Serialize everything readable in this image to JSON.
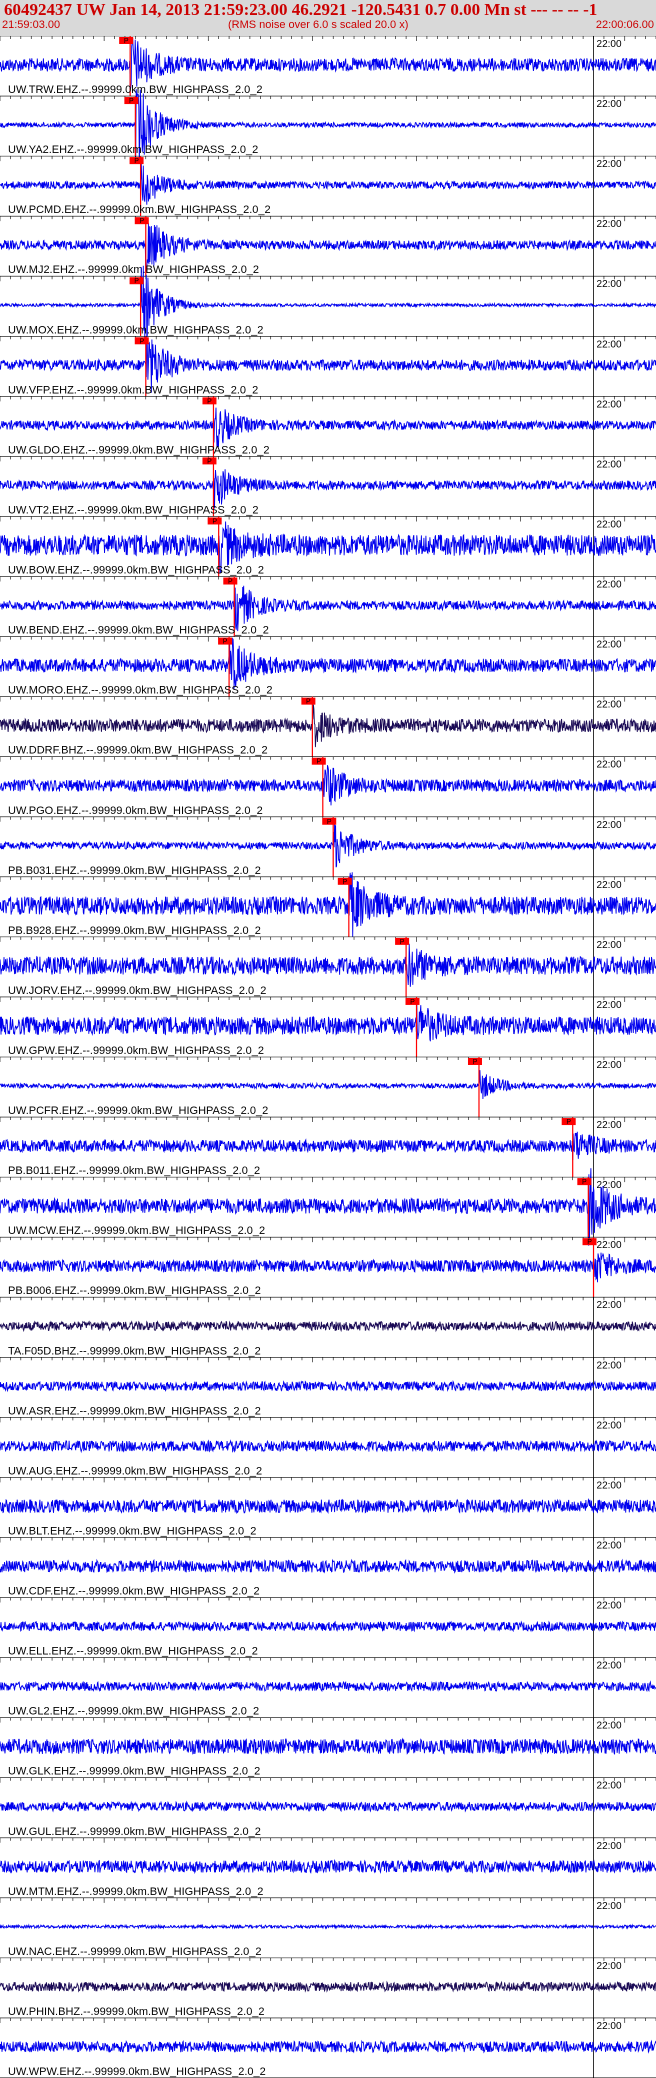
{
  "header": {
    "title": "60492437 UW Jan 14, 2013 21:59:23.00   46.2921 -120.5431  0.7 0.00 Mn st --- -- --  -1",
    "start_time": "21:59:03.00",
    "end_time": "22:00:06.00",
    "subtitle": "(RMS noise over 6.0 s scaled 20.0 x)"
  },
  "colors": {
    "background": "#ffffff",
    "header_bg": "#d9d9d9",
    "header_text": "#cc0000",
    "trace": "#0000ee",
    "trace_dark": "#1a0a55",
    "pick": "#ff0000",
    "label": "#000000"
  },
  "chart_data": {
    "type": "line",
    "x_unit": "time",
    "xlim": [
      "21:59:03.00",
      "22:00:06.00"
    ],
    "tick_interval_s": 1,
    "minute_tick_label": "22:00",
    "pick_label": "P",
    "traces": [
      {
        "label": "UW.TRW.EHZ.--.99999.0km.BW_HIGHPASS_2.0_2",
        "pick_s": 12.5,
        "amp": 0.22,
        "burst": 1.0,
        "color": "trace"
      },
      {
        "label": "UW.YA2.EHZ.--.99999.0km.BW_HIGHPASS_2.0_2",
        "pick_s": 13.0,
        "amp": 0.08,
        "burst": 1.6,
        "color": "trace"
      },
      {
        "label": "UW.PCMD.EHZ.--.99999.0km.BW_HIGHPASS_2.0_2",
        "pick_s": 13.5,
        "amp": 0.12,
        "burst": 0.8,
        "color": "trace"
      },
      {
        "label": "UW.MJ2.EHZ.--.99999.0km.BW_HIGHPASS_2.0_2",
        "pick_s": 14.0,
        "amp": 0.15,
        "burst": 1.0,
        "color": "trace"
      },
      {
        "label": "UW.MOX.EHZ.--.99999.0km.BW_HIGHPASS_2.0_2",
        "pick_s": 13.5,
        "amp": 0.05,
        "burst": 1.5,
        "color": "trace"
      },
      {
        "label": "UW.VFP.EHZ.--.99999.0km.BW_HIGHPASS_2.0_2",
        "pick_s": 14.0,
        "amp": 0.18,
        "burst": 1.1,
        "color": "trace"
      },
      {
        "label": "UW.GLDO.EHZ.--.99999.0km.BW_HIGHPASS_2.0_2",
        "pick_s": 20.5,
        "amp": 0.15,
        "burst": 0.8,
        "color": "trace"
      },
      {
        "label": "UW.VT2.EHZ.--.99999.0km.BW_HIGHPASS_2.0_2",
        "pick_s": 20.5,
        "amp": 0.15,
        "burst": 0.8,
        "color": "trace"
      },
      {
        "label": "UW.BOW.EHZ.--.99999.0km.BW_HIGHPASS_2.0_2",
        "pick_s": 21.0,
        "amp": 0.35,
        "burst": 0.7,
        "color": "trace"
      },
      {
        "label": "UW.BEND.EHZ.--.99999.0km.BW_HIGHPASS_2.0_2",
        "pick_s": 22.5,
        "amp": 0.15,
        "burst": 0.9,
        "color": "trace"
      },
      {
        "label": "UW.MORO.EHZ.--.99999.0km.BW_HIGHPASS_2.0_2",
        "pick_s": 22.0,
        "amp": 0.22,
        "burst": 0.9,
        "color": "trace"
      },
      {
        "label": "UW.DDRF.BHZ.--.99999.0km.BW_HIGHPASS_2.0_2",
        "pick_s": 30.0,
        "amp": 0.22,
        "burst": 0.6,
        "color": "trace_dark"
      },
      {
        "label": "UW.PGO.EHZ.--.99999.0km.BW_HIGHPASS_2.0_2",
        "pick_s": 31.0,
        "amp": 0.2,
        "burst": 0.8,
        "color": "trace"
      },
      {
        "label": "PB.B031.EHZ.--.99999.0km.BW_HIGHPASS_2.0_2",
        "pick_s": 32.0,
        "amp": 0.12,
        "burst": 0.8,
        "color": "trace"
      },
      {
        "label": "PB.B928.EHZ.--.99999.0km.BW_HIGHPASS_2.0_2",
        "pick_s": 33.5,
        "amp": 0.3,
        "burst": 1.0,
        "color": "trace"
      },
      {
        "label": "UW.JORV.EHZ.--.99999.0km.BW_HIGHPASS_2.0_2",
        "pick_s": 39.0,
        "amp": 0.3,
        "burst": 0.6,
        "color": "trace"
      },
      {
        "label": "UW.GPW.EHZ.--.99999.0km.BW_HIGHPASS_2.0_2",
        "pick_s": 40.0,
        "amp": 0.3,
        "burst": 0.6,
        "color": "trace"
      },
      {
        "label": "UW.PCFR.EHZ.--.99999.0km.BW_HIGHPASS_2.0_2",
        "pick_s": 46.0,
        "amp": 0.08,
        "burst": 0.5,
        "color": "trace"
      },
      {
        "label": "PB.B011.EHZ.--.99999.0km.BW_HIGHPASS_2.0_2",
        "pick_s": 55.0,
        "amp": 0.2,
        "burst": 0.5,
        "color": "trace"
      },
      {
        "label": "UW.MCW.EHZ.--.99999.0km.BW_HIGHPASS_2.0_2",
        "pick_s": 56.5,
        "amp": 0.25,
        "burst": 1.2,
        "color": "trace"
      },
      {
        "label": "PB.B006.EHZ.--.99999.0km.BW_HIGHPASS_2.0_2",
        "pick_s": 57.0,
        "amp": 0.2,
        "burst": 0.5,
        "color": "trace"
      },
      {
        "label": "TA.F05D.BHZ.--.99999.0km.BW_HIGHPASS_2.0_2",
        "pick_s": null,
        "amp": 0.15,
        "burst": 0,
        "color": "trace_dark"
      },
      {
        "label": "UW.ASR.EHZ.--.99999.0km.BW_HIGHPASS_2.0_2",
        "pick_s": null,
        "amp": 0.15,
        "burst": 0,
        "color": "trace"
      },
      {
        "label": "UW.AUG.EHZ.--.99999.0km.BW_HIGHPASS_2.0_2",
        "pick_s": null,
        "amp": 0.18,
        "burst": 0,
        "color": "trace"
      },
      {
        "label": "UW.BLT.EHZ.--.99999.0km.BW_HIGHPASS_2.0_2",
        "pick_s": null,
        "amp": 0.22,
        "burst": 0,
        "color": "trace"
      },
      {
        "label": "UW.CDF.EHZ.--.99999.0km.BW_HIGHPASS_2.0_2",
        "pick_s": null,
        "amp": 0.2,
        "burst": 0,
        "color": "trace"
      },
      {
        "label": "UW.ELL.EHZ.--.99999.0km.BW_HIGHPASS_2.0_2",
        "pick_s": null,
        "amp": 0.15,
        "burst": 0,
        "color": "trace"
      },
      {
        "label": "UW.GL2.EHZ.--.99999.0km.BW_HIGHPASS_2.0_2",
        "pick_s": null,
        "amp": 0.15,
        "burst": 0,
        "color": "trace"
      },
      {
        "label": "UW.GLK.EHZ.--.99999.0km.BW_HIGHPASS_2.0_2",
        "pick_s": null,
        "amp": 0.25,
        "burst": 0,
        "color": "trace"
      },
      {
        "label": "UW.GUL.EHZ.--.99999.0km.BW_HIGHPASS_2.0_2",
        "pick_s": null,
        "amp": 0.15,
        "burst": 0,
        "color": "trace"
      },
      {
        "label": "UW.MTM.EHZ.--.99999.0km.BW_HIGHPASS_2.0_2",
        "pick_s": null,
        "amp": 0.2,
        "burst": 0,
        "color": "trace"
      },
      {
        "label": "UW.NAC.EHZ.--.99999.0km.BW_HIGHPASS_2.0_2",
        "pick_s": null,
        "amp": 0.05,
        "burst": 0,
        "color": "trace"
      },
      {
        "label": "UW.PHIN.BHZ.--.99999.0km.BW_HIGHPASS_2.0_2",
        "pick_s": null,
        "amp": 0.15,
        "burst": 0,
        "color": "trace_dark"
      },
      {
        "label": "UW.WPW.EHZ.--.99999.0km.BW_HIGHPASS_2.0_2",
        "pick_s": null,
        "amp": 0.18,
        "burst": 0,
        "color": "trace"
      }
    ]
  }
}
